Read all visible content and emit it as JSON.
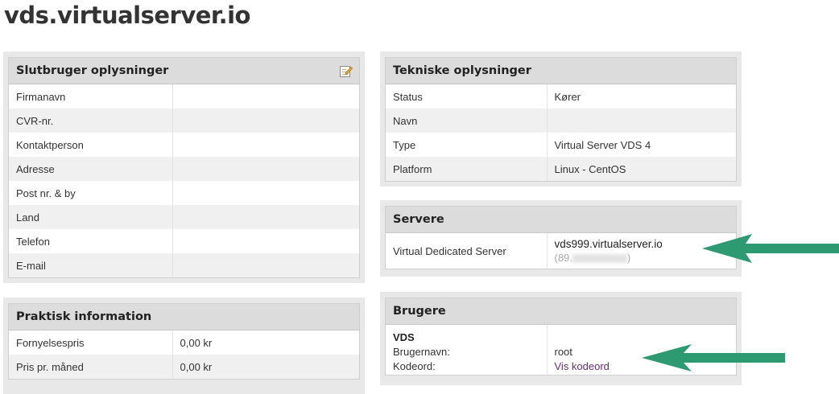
{
  "page": {
    "title": "vds.virtualserver.io"
  },
  "enduser": {
    "title": "Slutbruger oplysninger",
    "edit_icon": "edit-note-icon",
    "rows": [
      {
        "label": "Firmanavn",
        "value": ""
      },
      {
        "label": "CVR-nr.",
        "value": ""
      },
      {
        "label": "Kontaktperson",
        "value": ""
      },
      {
        "label": "Adresse",
        "value": ""
      },
      {
        "label": "Post nr. & by",
        "value": ""
      },
      {
        "label": "Land",
        "value": ""
      },
      {
        "label": "Telefon",
        "value": ""
      },
      {
        "label": "E-mail",
        "value": ""
      }
    ]
  },
  "practical": {
    "title": "Praktisk information",
    "rows": [
      {
        "label": "Fornyelsespris",
        "value": "0,00 kr"
      },
      {
        "label": "Pris pr. måned",
        "value": "0,00 kr"
      }
    ]
  },
  "technical": {
    "title": "Tekniske oplysninger",
    "rows": [
      {
        "label": "Status",
        "value": "Kører"
      },
      {
        "label": "Navn",
        "value": ""
      },
      {
        "label": "Type",
        "value": "Virtual Server VDS 4"
      },
      {
        "label": "Platform",
        "value": "Linux - CentOS"
      }
    ]
  },
  "servers": {
    "title": "Servere",
    "label": "Virtual Dedicated Server",
    "hostname": "vds999.virtualserver.io",
    "ip_open": "(89.",
    "ip_close": ")"
  },
  "users": {
    "title": "Brugere",
    "group": "VDS",
    "username_label": "Brugernavn:",
    "username_value": "root",
    "password_label": "Kodeord:",
    "password_link": "Vis kodeord"
  },
  "colors": {
    "arrow": "#2e9a72",
    "link": "#6b2a7e"
  }
}
